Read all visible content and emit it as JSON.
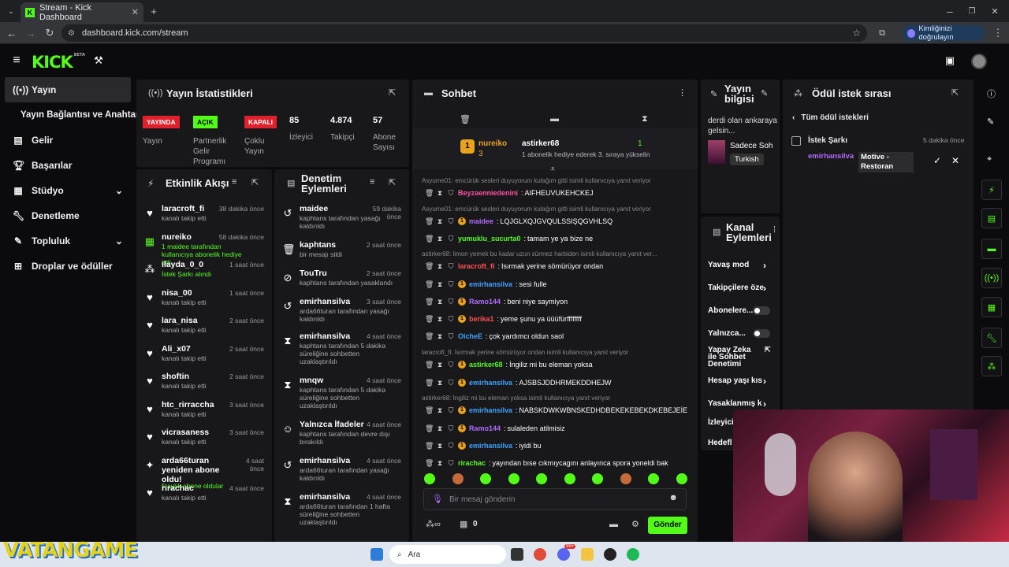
{
  "browser": {
    "tab_title": "Stream - Kick Dashboard",
    "url": "dashboard.kick.com/stream",
    "verify_label": "Kimliğinizi doğrulayın"
  },
  "brand": {
    "logo": "KICK",
    "beta": "BETA",
    "accent": "#53fc18"
  },
  "nav": {
    "items": [
      {
        "label": "Yayın",
        "icon": "broadcast-icon"
      },
      {
        "label": "Yayın Bağlantısı ve Anahtarı",
        "icon": ""
      },
      {
        "label": "Gelir",
        "icon": "revenue-icon"
      },
      {
        "label": "Başarılar",
        "icon": "trophy-icon"
      },
      {
        "label": "Stüdyo",
        "icon": "studio-icon"
      },
      {
        "label": "Denetleme",
        "icon": "wrench-icon"
      },
      {
        "label": "Topluluk",
        "icon": "community-icon"
      },
      {
        "label": "Droplar ve ödüller",
        "icon": "drops-icon"
      }
    ]
  },
  "stats": {
    "title": "Yayın İstatistikleri",
    "live_badge": "YAYINDA",
    "live_label": "Yayın",
    "program_badge": "AÇIK",
    "program_label": "Partnerlik Gelir Programı",
    "multi_badge": "KAPALI",
    "multi_label": "Çoklu Yayın",
    "viewers_value": "85",
    "viewers_label": "İzleyici",
    "followers_value": "4.874",
    "followers_label": "Takipçi",
    "subs_value": "57",
    "subs_label": "Abone Sayısı"
  },
  "activity": {
    "title": "Etkinlik Akışı",
    "items": [
      {
        "name": "laracroft_fi",
        "sub": "kanalı takip etti",
        "time": "38 dakika önce"
      },
      {
        "name": "nureiko",
        "sub": "1 maidee tarafından kullanıcıya abonelik hediye etti.",
        "time": "58 dakika önce"
      },
      {
        "name": "ilayda_0_0",
        "sub": "İstek Şarkı alındı",
        "time": "1 saat önce"
      },
      {
        "name": "nisa_00",
        "sub": "kanalı takip etti",
        "time": "1 saat önce"
      },
      {
        "name": "lara_nisa",
        "sub": "kanalı takip etti",
        "time": "2 saat önce"
      },
      {
        "name": "Ali_x07",
        "sub": "kanalı takip etti",
        "time": "2 saat önce"
      },
      {
        "name": "shoftin",
        "sub": "kanalı takip etti",
        "time": "2 saat önce"
      },
      {
        "name": "htc_rirraccha",
        "sub": "kanalı takip etti",
        "time": "3 saat önce"
      },
      {
        "name": "vicrasaness",
        "sub": "kanalı takip etti",
        "time": "3 saat önce"
      },
      {
        "name": "arda66turan yeniden abone oldu!",
        "sub": "5 aylık abone oldular",
        "time": "4 saat önce"
      },
      {
        "name": "rirachac",
        "sub": "kanalı takip etti",
        "time": "4 saat önce"
      }
    ]
  },
  "modactions": {
    "title": "Denetim Eylemleri",
    "items": [
      {
        "name": "maidee",
        "sub": "kaphtans tarafından yasağı kaldırıldı",
        "time": "59 dakika önce"
      },
      {
        "name": "kaphtans",
        "sub": "bir mesajı sildi",
        "time": "2 saat önce"
      },
      {
        "name": "TouTru",
        "sub": "kaphtans tarafından yasaklandı",
        "time": "2 saat önce"
      },
      {
        "name": "emirhansilva",
        "sub": "arda66turan tarafından yasağı kaldırıldı",
        "time": "3 saat önce"
      },
      {
        "name": "emirhansilva",
        "sub": "kaphtans tarafından 5 dakika süreliğine sohbetten uzaklaştırıldı",
        "time": "4 saat önce"
      },
      {
        "name": "mnqw",
        "sub": "kaphtans tarafından 5 dakika süreliğine sohbetten uzaklaştırıldı",
        "time": "4 saat önce"
      },
      {
        "name": "Yalnızca İfadeler",
        "sub": "kaphtans tarafından devre dışı bırakıldı",
        "time": "4 saat önce"
      },
      {
        "name": "emirhansilva",
        "sub": "arda66turan tarafından yasağı kaldırıldı",
        "time": "4 saat önce"
      },
      {
        "name": "emirhansilva",
        "sub": "arda66turan tarafından 1 hafta süreliğine sohbetten uzaklaştırıldı",
        "time": "4 saat önce"
      }
    ]
  },
  "chat": {
    "title": "Sohbet",
    "gift_user": "nureiko",
    "gift_count": "3",
    "gift_target": "astirker68",
    "gift_amount": "1",
    "gift_text": "1 abonelik hediye ederek 3. sıraya yükselin",
    "messages": [
      {
        "reply": "Asyume01: emcürük sesleri duyuyorum kulağım gitti isimli kullanıcıya yanıt veriyor",
        "user": "Beyzaenniedenini",
        "color": "#ff4fa3",
        "text": "AIFHEUVUKEHCKEJ"
      },
      {
        "reply": "Asyume01: emcürük sesleri duyuyorum kulağım gitti isimli kullanıcıya yanıt veriyor",
        "user": "maidee",
        "color": "#b16cff",
        "text": "LQJGLXQJGVQULSSIŞQGVHLSQ"
      },
      {
        "reply": "",
        "user": "yumuklu_sucurta0",
        "color": "#53fc18",
        "text": "tamam ye ya bize ne"
      },
      {
        "reply": "astirker68: limon yemek bu kadar uzun sürmez harbiden isimli kullanıcıya yanıt ver...",
        "user": "laracroft_fi",
        "color": "#ff4f4f",
        "text": "Isırmak yerine sömürüyor ondan"
      },
      {
        "reply": "",
        "user": "emirhansilva",
        "color": "#3aa4ff",
        "text": "sesi fulle"
      },
      {
        "reply": "",
        "user": "Ramo144",
        "color": "#b16cff",
        "text": "beni niye saymiyon"
      },
      {
        "reply": "",
        "user": "berika1",
        "color": "#ff4f4f",
        "text": "yeme şunu ya üüüfürffffffff"
      },
      {
        "reply": "",
        "user": "OicheE",
        "color": "#3aa4ff",
        "text": "çok yardımcı oldun saol"
      },
      {
        "reply": "laracroft_fi: Isırmak yerine sömürüyor ondan isimli kullanıcıya yanıt veriyor",
        "user": "astirker68",
        "color": "#53fc18",
        "text": "İngiliz mi bu eleman yoksa"
      },
      {
        "reply": "",
        "user": "emirhansilva",
        "color": "#3aa4ff",
        "text": "AJSBSJDDHRMEKDDHEJW"
      },
      {
        "reply": "astirker68: İngiliz mi bu eleman yoksa isimli kullanıcıya yanıt veriyor",
        "user": "emirhansilva",
        "color": "#3aa4ff",
        "text": "NABSKDWKWBNSKEDHDBEKEKEBEKDKEBEJEİE"
      },
      {
        "reply": "",
        "user": "Ramo144",
        "color": "#b16cff",
        "text": "sulaleden atilmisiz"
      },
      {
        "reply": "",
        "user": "emirhansilva",
        "color": "#3aa4ff",
        "text": "iyidi bu"
      },
      {
        "reply": "",
        "user": "rirachac",
        "color": "#53fc18",
        "text": "yayından bıse cıkmıycagını anlayınca spora yoneldi bak"
      }
    ],
    "input_placeholder": "Bir mesaj gönderin",
    "points": "0",
    "send_label": "Gönder"
  },
  "streaminfo": {
    "title": "Yayın bilgisi",
    "desc": "derdi olan ankaraya gelsin...",
    "category": "Sadece Soh",
    "language": "Turkish"
  },
  "channel": {
    "title": "Kanal Eylemleri",
    "rows": [
      "Yavaş mod",
      "Takipçilere öze",
      "Abonelere...",
      "Yalnızca...",
      "Yapay Zeka ile Sohbet Denetimi",
      "Hesap yaşı kıs",
      "Yasaklanmış k",
      "İzleyici",
      "Hedefl"
    ]
  },
  "rewards": {
    "title": "Ödül istek sırası",
    "back_label": "Tüm ödül istekleri",
    "item_title": "İstek Şarkı",
    "item_time": "5 dakika önce",
    "item_user": "emirhansilva",
    "item_text": "Motive - Restoran"
  },
  "taskbar": {
    "search": "Ara",
    "badge": "99+"
  },
  "watermark": "VATANGAME"
}
